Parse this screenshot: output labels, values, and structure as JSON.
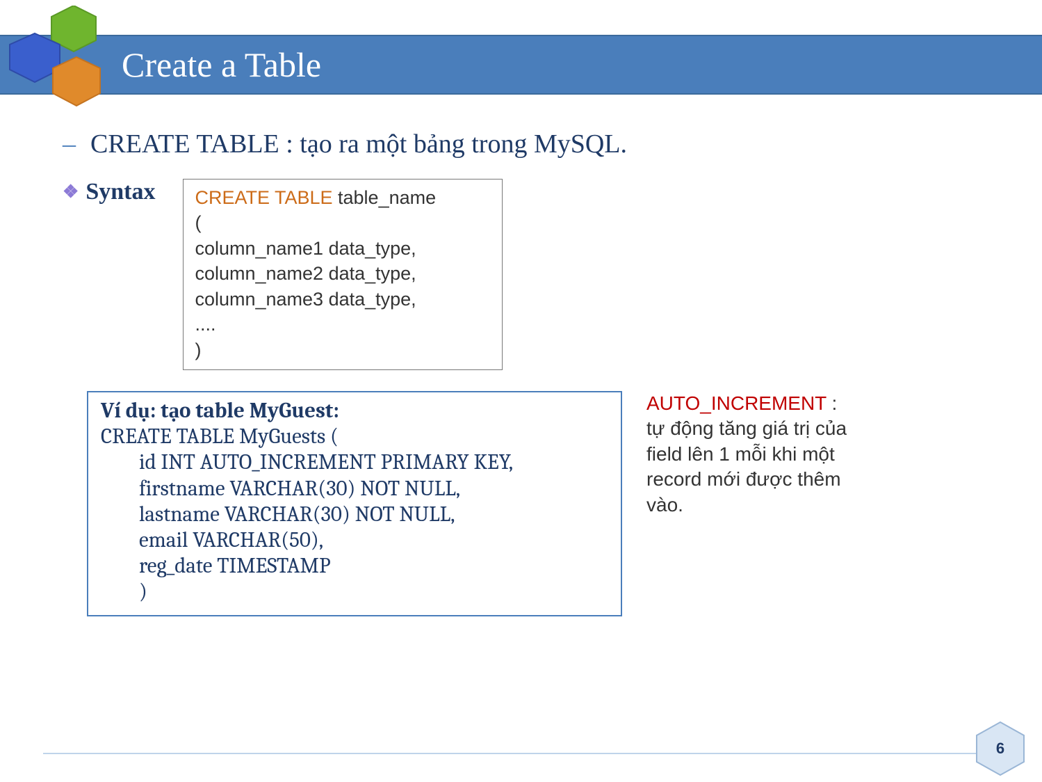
{
  "title": "Create a Table",
  "bullet1": "CREATE TABLE : tạo ra một bảng trong MySQL.",
  "syntax_label": "Syntax",
  "syntax_box": {
    "keyword": "CREATE TABLE",
    "after_kw": " table_name",
    "open": "(",
    "l1": "column_name1 data_type,",
    "l2": "column_name2 data_type,",
    "l3": "column_name3 data_type,",
    "dots": "....",
    "close": ")"
  },
  "example": {
    "title": "Ví dụ: tạo table MyGuest:",
    "l0": "CREATE TABLE MyGuests (",
    "l1": "id INT AUTO_INCREMENT PRIMARY KEY,",
    "l2": "firstname VARCHAR(30) NOT NULL,",
    "l3": "lastname VARCHAR(30) NOT NULL,",
    "l4": "email VARCHAR(50),",
    "l5": "reg_date TIMESTAMP",
    "l6": ")"
  },
  "note": {
    "key": "AUTO_INCREMENT",
    "rest": " : tự động tăng giá trị của field lên 1 mỗi khi một record mới được thêm vào."
  },
  "page_number": "6"
}
